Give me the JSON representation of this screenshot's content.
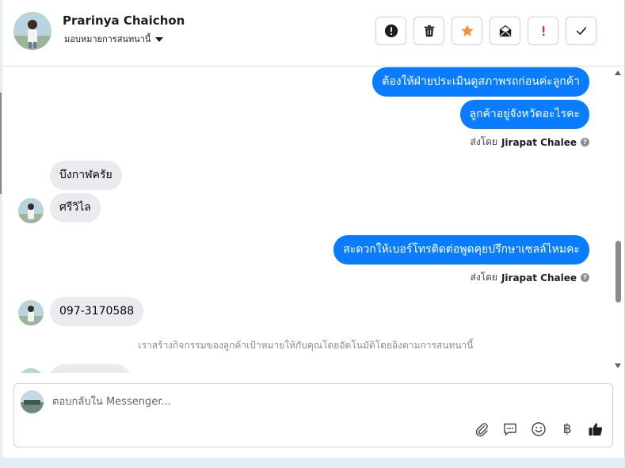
{
  "header": {
    "contact_name": "Prarinya Chaichon",
    "assign_label": "มอบหมายการสนทนานี้"
  },
  "actions": [
    {
      "name": "alert-button",
      "icon": "exclamation-circle-icon"
    },
    {
      "name": "delete-button",
      "icon": "trash-icon"
    },
    {
      "name": "star-button",
      "icon": "star-icon",
      "color": "#f7923b"
    },
    {
      "name": "mark-unread-button",
      "icon": "envelope-icon"
    },
    {
      "name": "important-button",
      "icon": "red-exclamation-icon",
      "color": "#e41e3f"
    },
    {
      "name": "done-button",
      "icon": "checkmark-icon"
    }
  ],
  "messages": [
    {
      "dir": "out",
      "text": "ต้องให้ฝ่ายประเมินดูสภาพรถก่อนค่ะลูกค้า"
    },
    {
      "dir": "out",
      "text": "ลูกค้าอยู่จังหวัดอะไรคะ"
    },
    {
      "dir": "sent_by",
      "prefix": "ส่งโดย",
      "agent": "Jirapat Chalee"
    },
    {
      "dir": "in",
      "text": "บึงกาฬครัย"
    },
    {
      "dir": "in",
      "text": "ศรีวิไล"
    },
    {
      "dir": "out",
      "text": "สะดวกให้เบอร์โทรติดต่อพูดคุยปรึกษาเซลล์ไหมคะ"
    },
    {
      "dir": "sent_by",
      "prefix": "ส่งโดย",
      "agent": "Jirapat Chalee"
    },
    {
      "dir": "in",
      "text": "097-3170588"
    },
    {
      "dir": "system",
      "text": "เราสร้างกิจกรรมของลูกค้าเป้าหมายให้กับคุณโดยอัตโนมัติโดยอิงตามการสนทนานี้"
    }
  ],
  "composer": {
    "placeholder": "ตอบกลับใน Messenger...",
    "tools": [
      "paperclip-icon",
      "saved-reply-icon",
      "emoji-icon",
      "baht-icon",
      "thumbs-up-icon"
    ],
    "baht_symbol": "฿"
  },
  "colors": {
    "outgoing_bubble": "#0a7cff",
    "incoming_bubble": "#e9ebee"
  }
}
